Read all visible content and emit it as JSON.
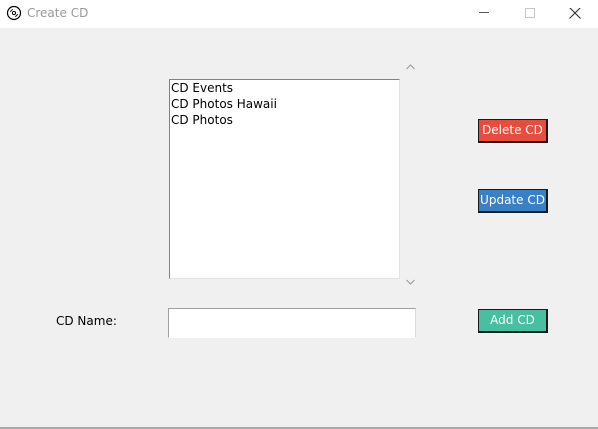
{
  "window": {
    "title": "Create CD",
    "icon": "cd-icon"
  },
  "titlebar_controls": {
    "minimize_icon": "minimize-icon",
    "maximize_icon": "maximize-icon",
    "close_icon": "close-icon"
  },
  "cd_list": {
    "items": [
      "CD Events",
      "CD Photos Hawaii",
      "CD Photos"
    ]
  },
  "scrollbar": {
    "up_icon": "chevron-up-icon",
    "down_icon": "chevron-down-icon"
  },
  "form": {
    "name_label": "CD Name:",
    "name_value": ""
  },
  "buttons": {
    "delete_label": "Delete CD",
    "update_label": "Update CD",
    "add_label": "Add CD"
  },
  "colors": {
    "delete": "#e84c3d",
    "update": "#3a80c4",
    "add": "#47bfa0"
  }
}
